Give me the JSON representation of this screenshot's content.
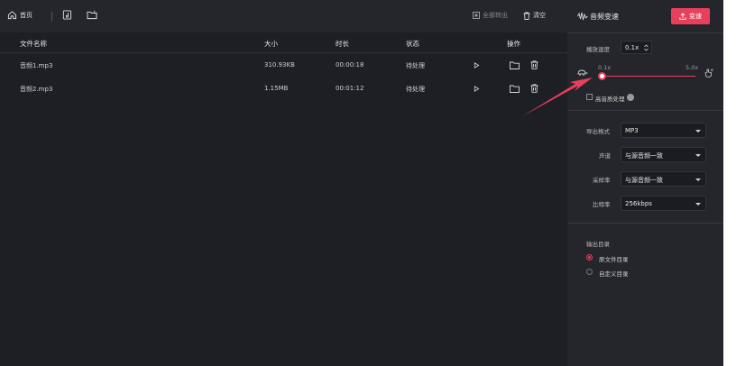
{
  "toolbar": {
    "home_label": "首页",
    "start_all_label": "全部转出",
    "clear_label": "清空"
  },
  "table": {
    "columns": {
      "name": "文件名称",
      "size": "大小",
      "duration": "时长",
      "status": "状态",
      "actions": "操作"
    },
    "rows": [
      {
        "name": "音频1.mp3",
        "size": "310.93KB",
        "duration": "00:00:18",
        "status": "待处理"
      },
      {
        "name": "音频2.mp3",
        "size": "1.15MB",
        "duration": "00:01:12",
        "status": "待处理"
      }
    ]
  },
  "panel": {
    "title": "音频变速",
    "convert_label": "变速",
    "speed_label": "播放速度",
    "speed_value": "0.1x",
    "slider": {
      "min_label": "0.1x",
      "max_label": "5.0x",
      "value": 0.1,
      "min": 0.1,
      "max": 5.0
    },
    "pitch_label": "高音质处理",
    "format_label": "导出格式",
    "format_value": "MP3",
    "channel_label": "声道",
    "channel_value": "与源音频一致",
    "samplerate_label": "采样率",
    "samplerate_value": "与源音频一致",
    "bitrate_label": "比特率",
    "bitrate_value": "256kbps",
    "output_label": "输出目录",
    "output_options": [
      "原文件目录",
      "自定义目录"
    ],
    "output_selected": 0
  },
  "colors": {
    "accent": "#e8405c",
    "background": "#1e1f24",
    "panel": "#25262b",
    "arrow": "#e8405c"
  }
}
